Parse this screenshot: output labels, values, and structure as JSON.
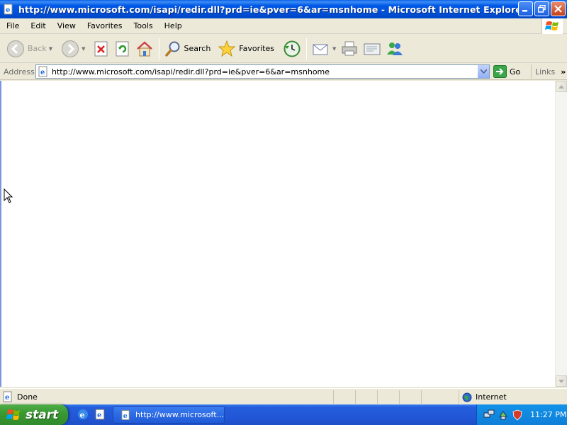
{
  "window": {
    "title": "http://www.microsoft.com/isapi/redir.dll?prd=ie&pver=6&ar=msnhome - Microsoft Internet Explorer"
  },
  "menu": [
    "File",
    "Edit",
    "View",
    "Favorites",
    "Tools",
    "Help"
  ],
  "toolbar": {
    "back_label": "Back",
    "search_label": "Search",
    "favorites_label": "Favorites"
  },
  "address": {
    "label": "Address",
    "url": "http://www.microsoft.com/isapi/redir.dll?prd=ie&pver=6&ar=msnhome",
    "go_label": "Go",
    "links_label": "Links"
  },
  "status": {
    "text": "Done",
    "zone": "Internet"
  },
  "taskbar": {
    "start_label": "start",
    "task_label": "http://www.microsoft...",
    "clock": "11:27 PM"
  },
  "colors": {
    "titlebar": "#0054e3",
    "chrome": "#ece9d8",
    "start": "#3a9a33",
    "taskbar": "#245edb"
  },
  "icons": {
    "title": "ie-page-icon",
    "back": "back-arrow-icon",
    "forward": "forward-arrow-icon",
    "stop": "stop-icon",
    "refresh": "refresh-icon",
    "home": "home-icon",
    "search": "search-icon",
    "favorites": "star-icon",
    "history": "history-icon",
    "mail": "mail-icon",
    "print": "printer-icon",
    "edit": "edit-icon",
    "messenger": "messenger-icon"
  }
}
